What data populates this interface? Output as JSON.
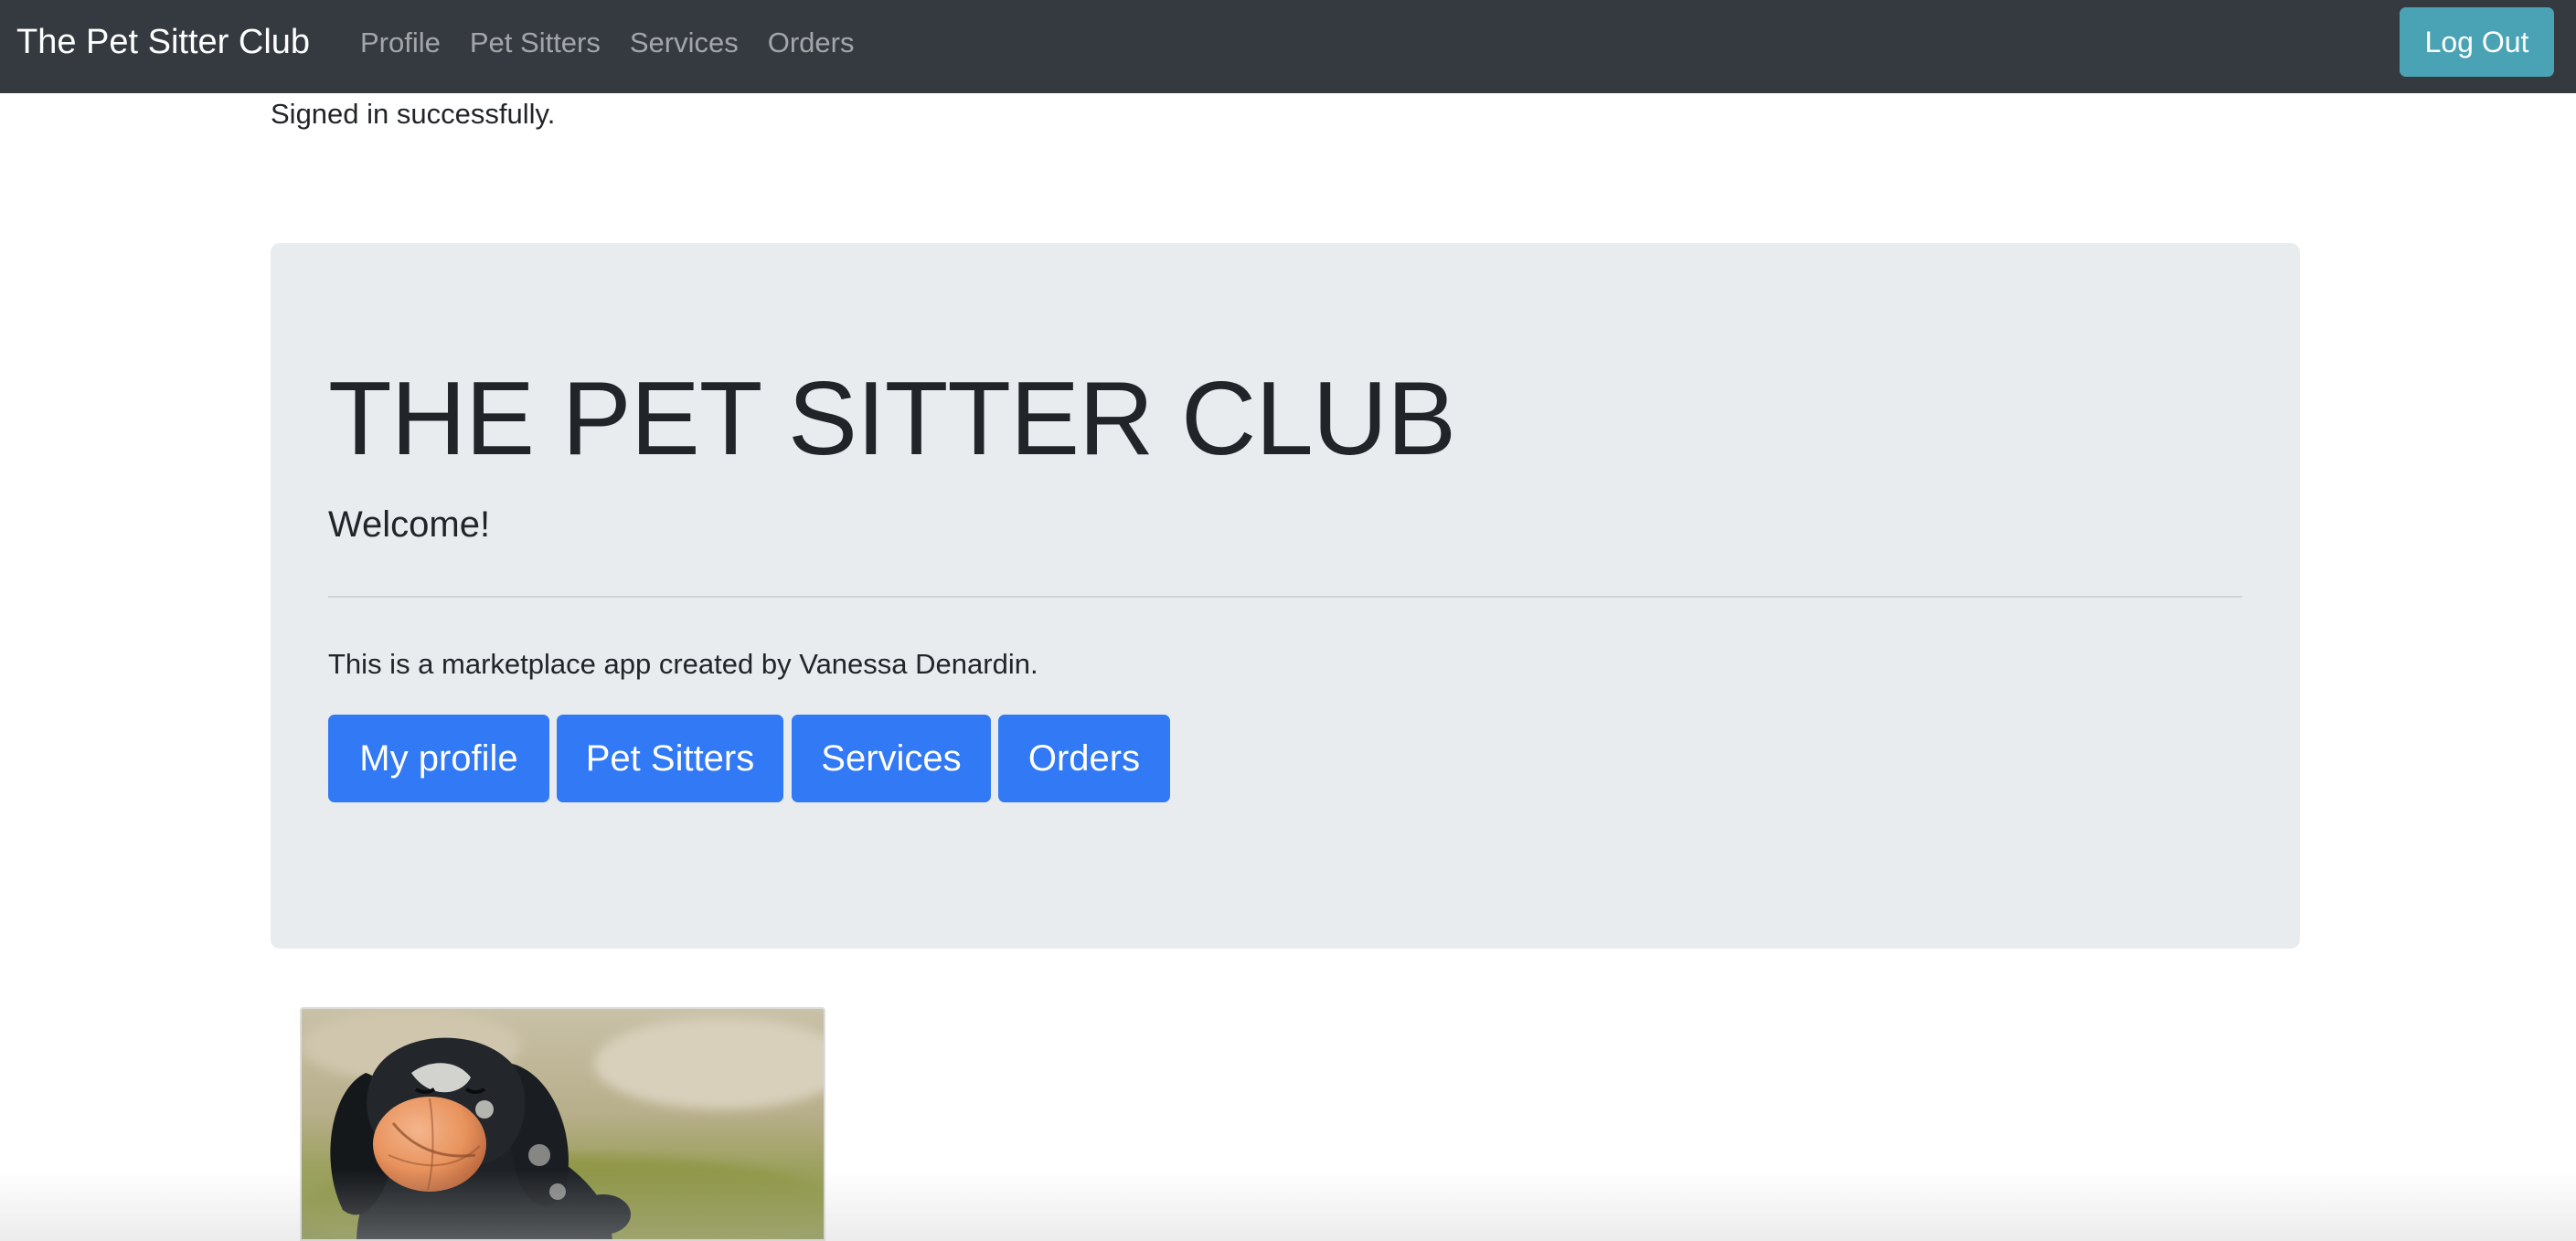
{
  "navbar": {
    "brand": "The Pet Sitter Club",
    "links": [
      {
        "label": "Profile"
      },
      {
        "label": "Pet Sitters"
      },
      {
        "label": "Services"
      },
      {
        "label": "Orders"
      }
    ],
    "logout_label": "Log Out",
    "background_color": "#343a40",
    "logout_color": "#4aa3b4"
  },
  "flash": {
    "message": "Signed in successfully."
  },
  "jumbotron": {
    "title": "THE PET SITTER CLUB",
    "lead": "Welcome!",
    "text": "This is a marketplace app created by Vanessa Denardin.",
    "buttons": [
      {
        "label": "My profile"
      },
      {
        "label": "Pet Sitters"
      },
      {
        "label": "Services"
      },
      {
        "label": "Orders"
      }
    ],
    "background_color": "#e9ecef",
    "button_color": "#3179f5"
  },
  "photo": {
    "subject": "dog-with-ball"
  }
}
